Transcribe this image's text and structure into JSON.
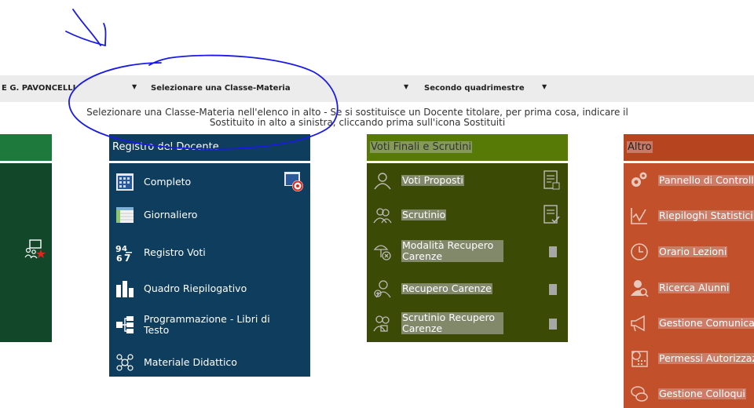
{
  "selbar": {
    "school": "E G. PAVONCELLI",
    "classe_materia": "Selezionare una Classe-Materia",
    "periodo": "Secondo quadrimestre",
    "arrow": "▼"
  },
  "info": {
    "line1": "Selezionare una Classe-Materia nell'elenco in alto - Se si sostituisce un Docente titolare, per prima cosa, indicare il",
    "line2": "Sostituito in alto a sinistra, cliccando prima sull'icona Sostituiti"
  },
  "registro": {
    "title": "Registro del Docente",
    "items": [
      {
        "label": "Completo"
      },
      {
        "label": "Giornaliero"
      },
      {
        "label": "Registro Voti"
      },
      {
        "label": "Quadro Riepilogativo"
      },
      {
        "label": "Programmazione - Libri di Testo"
      },
      {
        "label": "Materiale Didattico"
      }
    ]
  },
  "voti": {
    "title": "Voti Finali e Scrutini",
    "items": [
      {
        "label": "Voti Proposti"
      },
      {
        "label": "Scrutinio"
      },
      {
        "label": "Modalità Recupero Carenze"
      },
      {
        "label": "Recupero Carenze"
      },
      {
        "label": "Scrutinio Recupero Carenze"
      }
    ]
  },
  "altro": {
    "title": "Altro",
    "items": [
      {
        "label": "Pannello di Controllo"
      },
      {
        "label": "Riepiloghi Statistici"
      },
      {
        "label": "Orario Lezioni"
      },
      {
        "label": "Ricerca Alunni"
      },
      {
        "label": "Gestione Comunicazioni"
      },
      {
        "label": "Permessi Autorizzazioni"
      },
      {
        "label": "Gestione Colloqui"
      }
    ]
  },
  "colors": {
    "green_head": "#1e7a3c",
    "green_body": "#13472a",
    "blue": "#0e3d5e",
    "olive_head": "#577a06",
    "olive_body": "#3b4b06",
    "red_head": "#b5441f",
    "red_body": "#c2502a",
    "annotation": "#1a1ae6"
  }
}
